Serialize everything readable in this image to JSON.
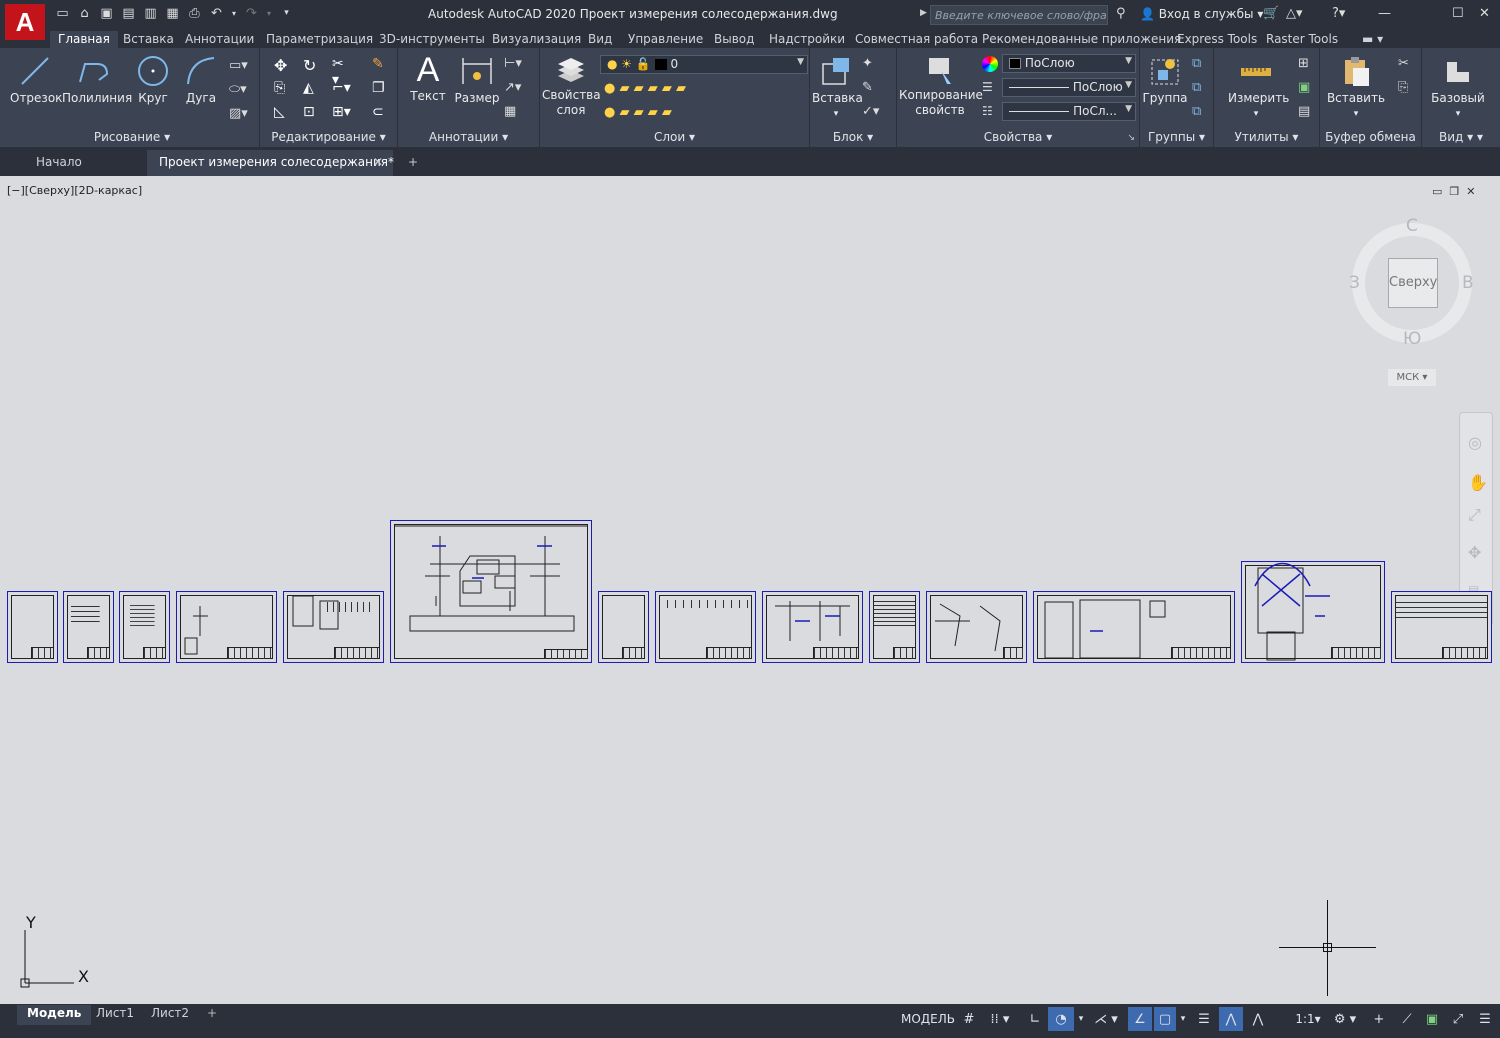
{
  "app": {
    "logo": "A",
    "title": "Autodesk AutoCAD 2020   Проект измерения солесодержания.dwg",
    "search_placeholder": "Введите ключевое слово/фразу",
    "signin": "Вход в службы"
  },
  "ribbon_tabs": [
    "Главная",
    "Вставка",
    "Аннотации",
    "Параметризация",
    "3D-инструменты",
    "Визуализация",
    "Вид",
    "Управление",
    "Вывод",
    "Надстройки",
    "Совместная работа",
    "Рекомендованные приложения",
    "Express Tools",
    "Raster Tools"
  ],
  "panels": {
    "draw": {
      "title": "Рисование",
      "line": "Отрезок",
      "polyline": "Полилиния",
      "circle": "Круг",
      "arc": "Дуга"
    },
    "modify": {
      "title": "Редактирование"
    },
    "annotation": {
      "title": "Аннотации",
      "text": "Текст",
      "dimension": "Размер"
    },
    "layers": {
      "title": "Слои",
      "layer_props_1": "Свойства",
      "layer_props_2": "слоя",
      "current_layer": "0"
    },
    "block": {
      "title": "Блок",
      "insert": "Вставка"
    },
    "properties": {
      "title": "Свойства",
      "match_1": "Копирование",
      "match_2": "свойств",
      "color": "ПоСлою",
      "linetype": "ПоСлою",
      "lineweight": "ПоСл..."
    },
    "groups": {
      "title": "Группы",
      "group": "Группа"
    },
    "utilities": {
      "title": "Утилиты",
      "measure": "Измерить"
    },
    "clipboard": {
      "title": "Буфер обмена",
      "paste": "Вставить"
    },
    "view": {
      "title": "Вид",
      "base": "Базовый"
    }
  },
  "file_tabs": {
    "start": "Начало",
    "current": "Проект измерения солесодержания*",
    "add": "+"
  },
  "viewport": {
    "label": "[−][Сверху][2D-каркас]"
  },
  "viewcube": {
    "face": "Сверху",
    "north": "С",
    "south": "Ю",
    "west": "З",
    "east": "В",
    "wcs": "МСК"
  },
  "ucs": {
    "x": "X",
    "y": "Y"
  },
  "layout_tabs": [
    "Модель",
    "Лист1",
    "Лист2"
  ],
  "layout_add": "+",
  "status": {
    "model": "МОДЕЛЬ",
    "scale": "1:1"
  }
}
